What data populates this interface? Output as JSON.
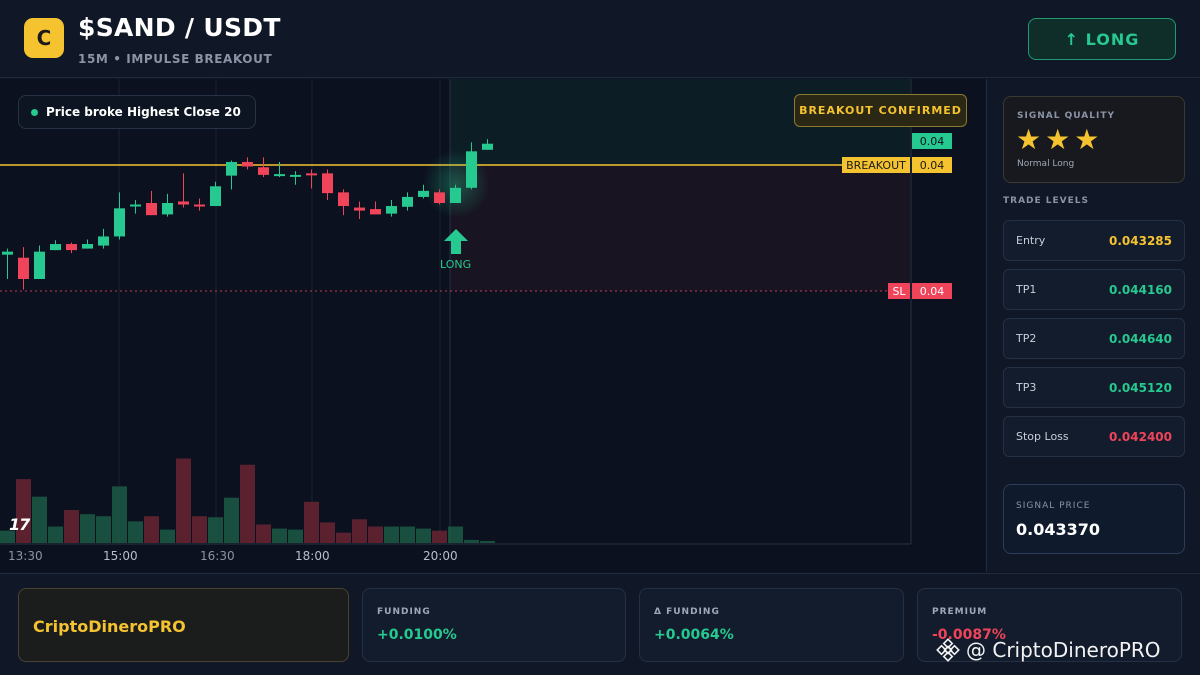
{
  "header": {
    "logo_letter": "C",
    "pair": "$SAND / USDT",
    "subtitle": "15M • IMPULSE BREAKOUT",
    "long_button": "↑ LONG"
  },
  "chart": {
    "signal_pill": "Price broke Highest Close 20",
    "confirm_badge": "BREAKOUT CONFIRMED",
    "breakout_label": "BREAKOUT",
    "breakout_value": "0.04",
    "price_value": "0.04",
    "sl_label": "SL",
    "sl_value": "0.04",
    "long_marker": "LONG",
    "tv_logo": "17",
    "x_labels": [
      "13:30",
      "15:00",
      "16:30",
      "18:00",
      "20:00"
    ],
    "colors": {
      "up": "#26c98f",
      "down": "#f0445a",
      "breakout": "#f5c330",
      "sl": "#f0445a"
    }
  },
  "chart_data": {
    "type": "candlestick",
    "x_ticks": [
      "13:30",
      "15:00",
      "16:30",
      "18:00",
      "20:00"
    ],
    "candles": [
      {
        "o": 0.03938,
        "h": 0.03946,
        "l": 0.03906,
        "c": 0.03942
      },
      {
        "o": 0.03934,
        "h": 0.03948,
        "l": 0.03892,
        "c": 0.03906
      },
      {
        "o": 0.03906,
        "h": 0.0395,
        "l": 0.03906,
        "c": 0.03942
      },
      {
        "o": 0.03944,
        "h": 0.03957,
        "l": 0.03944,
        "c": 0.03952
      },
      {
        "o": 0.03952,
        "h": 0.03954,
        "l": 0.0394,
        "c": 0.03944
      },
      {
        "o": 0.03946,
        "h": 0.03958,
        "l": 0.03946,
        "c": 0.03952
      },
      {
        "o": 0.0395,
        "h": 0.03972,
        "l": 0.03946,
        "c": 0.03962
      },
      {
        "o": 0.03962,
        "h": 0.0402,
        "l": 0.03958,
        "c": 0.03999
      },
      {
        "o": 0.04002,
        "h": 0.0401,
        "l": 0.03992,
        "c": 0.04004
      },
      {
        "o": 0.04006,
        "h": 0.04022,
        "l": 0.0399,
        "c": 0.0399
      },
      {
        "o": 0.03991,
        "h": 0.04018,
        "l": 0.03988,
        "c": 0.04006
      },
      {
        "o": 0.04008,
        "h": 0.04045,
        "l": 0.04,
        "c": 0.04004
      },
      {
        "o": 0.04004,
        "h": 0.04012,
        "l": 0.03996,
        "c": 0.04002
      },
      {
        "o": 0.04002,
        "h": 0.04034,
        "l": 0.04002,
        "c": 0.04028
      },
      {
        "o": 0.04042,
        "h": 0.04062,
        "l": 0.04024,
        "c": 0.0406
      },
      {
        "o": 0.0406,
        "h": 0.04066,
        "l": 0.0405,
        "c": 0.04054
      },
      {
        "o": 0.04053,
        "h": 0.04066,
        "l": 0.0404,
        "c": 0.04043
      },
      {
        "o": 0.04042,
        "h": 0.0406,
        "l": 0.0404,
        "c": 0.04044
      },
      {
        "o": 0.04043,
        "h": 0.04048,
        "l": 0.0403,
        "c": 0.04043
      },
      {
        "o": 0.04045,
        "h": 0.0405,
        "l": 0.04025,
        "c": 0.04043
      },
      {
        "o": 0.04045,
        "h": 0.0405,
        "l": 0.0401,
        "c": 0.04019
      },
      {
        "o": 0.0402,
        "h": 0.04024,
        "l": 0.0399,
        "c": 0.04002
      },
      {
        "o": 0.04,
        "h": 0.04008,
        "l": 0.03985,
        "c": 0.03996
      },
      {
        "o": 0.03998,
        "h": 0.04008,
        "l": 0.03992,
        "c": 0.03991
      },
      {
        "o": 0.03992,
        "h": 0.0401,
        "l": 0.03988,
        "c": 0.04002
      },
      {
        "o": 0.04001,
        "h": 0.0402,
        "l": 0.03996,
        "c": 0.04014
      },
      {
        "o": 0.04014,
        "h": 0.0403,
        "l": 0.04012,
        "c": 0.04022
      },
      {
        "o": 0.0402,
        "h": 0.04024,
        "l": 0.04004,
        "c": 0.04006
      },
      {
        "o": 0.04006,
        "h": 0.0403,
        "l": 0.04006,
        "c": 0.04026
      },
      {
        "o": 0.04026,
        "h": 0.04086,
        "l": 0.04024,
        "c": 0.04074
      },
      {
        "o": 0.04076,
        "h": 0.0409,
        "l": 0.04076,
        "c": 0.04084
      }
    ],
    "volumes": [
      1.2,
      6.2,
      4.5,
      1.6,
      3.2,
      2.8,
      2.6,
      5.5,
      2.1,
      2.6,
      1.3,
      8.2,
      2.6,
      2.5,
      4.4,
      7.6,
      1.8,
      1.4,
      1.3,
      4.0,
      2.0,
      1.0,
      2.3,
      1.6,
      1.6,
      1.6,
      1.4,
      1.2,
      1.6,
      0.3,
      0.2
    ],
    "breakout_level": 0.04056,
    "stop_loss_level": 0.0424,
    "price_axis_label": "0.04",
    "breakout_axis_label": "0.04",
    "sl_axis_label": "0.04"
  },
  "panel": {
    "quality_title": "SIGNAL QUALITY",
    "stars": "★★★",
    "star_rating": 3,
    "quality_note": "Normal Long",
    "levels_title": "TRADE LEVELS",
    "levels": [
      {
        "name": "Entry",
        "value": "0.043285",
        "color": "#f5c330"
      },
      {
        "name": "TP1",
        "value": "0.044160",
        "color": "#26c98f"
      },
      {
        "name": "TP2",
        "value": "0.044640",
        "color": "#26c98f"
      },
      {
        "name": "TP3",
        "value": "0.045120",
        "color": "#26c98f"
      },
      {
        "name": "Stop Loss",
        "value": "0.042400",
        "color": "#f0445a"
      }
    ],
    "signal_price_title": "SIGNAL PRICE",
    "signal_price": "0.043370"
  },
  "footer": {
    "brand": "CriptoDineroPRO",
    "stats": [
      {
        "title": "FUNDING",
        "value": "+0.0100%",
        "color": "#26c98f"
      },
      {
        "title": "Δ FUNDING",
        "value": "+0.0064%",
        "color": "#26c98f"
      },
      {
        "title": "PREMIUM",
        "value": "-0.0087%",
        "color": "#f0445a"
      }
    ],
    "watermark": "@ CriptoDineroPRO"
  }
}
